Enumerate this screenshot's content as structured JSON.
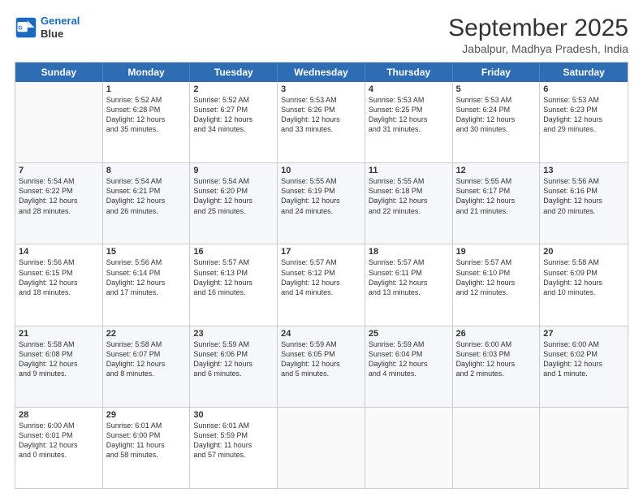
{
  "logo": {
    "line1": "General",
    "line2": "Blue"
  },
  "title": "September 2025",
  "subtitle": "Jabalpur, Madhya Pradesh, India",
  "header_days": [
    "Sunday",
    "Monday",
    "Tuesday",
    "Wednesday",
    "Thursday",
    "Friday",
    "Saturday"
  ],
  "rows": [
    [
      {
        "day": "",
        "info": ""
      },
      {
        "day": "1",
        "info": "Sunrise: 5:52 AM\nSunset: 6:28 PM\nDaylight: 12 hours\nand 35 minutes."
      },
      {
        "day": "2",
        "info": "Sunrise: 5:52 AM\nSunset: 6:27 PM\nDaylight: 12 hours\nand 34 minutes."
      },
      {
        "day": "3",
        "info": "Sunrise: 5:53 AM\nSunset: 6:26 PM\nDaylight: 12 hours\nand 33 minutes."
      },
      {
        "day": "4",
        "info": "Sunrise: 5:53 AM\nSunset: 6:25 PM\nDaylight: 12 hours\nand 31 minutes."
      },
      {
        "day": "5",
        "info": "Sunrise: 5:53 AM\nSunset: 6:24 PM\nDaylight: 12 hours\nand 30 minutes."
      },
      {
        "day": "6",
        "info": "Sunrise: 5:53 AM\nSunset: 6:23 PM\nDaylight: 12 hours\nand 29 minutes."
      }
    ],
    [
      {
        "day": "7",
        "info": "Sunrise: 5:54 AM\nSunset: 6:22 PM\nDaylight: 12 hours\nand 28 minutes."
      },
      {
        "day": "8",
        "info": "Sunrise: 5:54 AM\nSunset: 6:21 PM\nDaylight: 12 hours\nand 26 minutes."
      },
      {
        "day": "9",
        "info": "Sunrise: 5:54 AM\nSunset: 6:20 PM\nDaylight: 12 hours\nand 25 minutes."
      },
      {
        "day": "10",
        "info": "Sunrise: 5:55 AM\nSunset: 6:19 PM\nDaylight: 12 hours\nand 24 minutes."
      },
      {
        "day": "11",
        "info": "Sunrise: 5:55 AM\nSunset: 6:18 PM\nDaylight: 12 hours\nand 22 minutes."
      },
      {
        "day": "12",
        "info": "Sunrise: 5:55 AM\nSunset: 6:17 PM\nDaylight: 12 hours\nand 21 minutes."
      },
      {
        "day": "13",
        "info": "Sunrise: 5:56 AM\nSunset: 6:16 PM\nDaylight: 12 hours\nand 20 minutes."
      }
    ],
    [
      {
        "day": "14",
        "info": "Sunrise: 5:56 AM\nSunset: 6:15 PM\nDaylight: 12 hours\nand 18 minutes."
      },
      {
        "day": "15",
        "info": "Sunrise: 5:56 AM\nSunset: 6:14 PM\nDaylight: 12 hours\nand 17 minutes."
      },
      {
        "day": "16",
        "info": "Sunrise: 5:57 AM\nSunset: 6:13 PM\nDaylight: 12 hours\nand 16 minutes."
      },
      {
        "day": "17",
        "info": "Sunrise: 5:57 AM\nSunset: 6:12 PM\nDaylight: 12 hours\nand 14 minutes."
      },
      {
        "day": "18",
        "info": "Sunrise: 5:57 AM\nSunset: 6:11 PM\nDaylight: 12 hours\nand 13 minutes."
      },
      {
        "day": "19",
        "info": "Sunrise: 5:57 AM\nSunset: 6:10 PM\nDaylight: 12 hours\nand 12 minutes."
      },
      {
        "day": "20",
        "info": "Sunrise: 5:58 AM\nSunset: 6:09 PM\nDaylight: 12 hours\nand 10 minutes."
      }
    ],
    [
      {
        "day": "21",
        "info": "Sunrise: 5:58 AM\nSunset: 6:08 PM\nDaylight: 12 hours\nand 9 minutes."
      },
      {
        "day": "22",
        "info": "Sunrise: 5:58 AM\nSunset: 6:07 PM\nDaylight: 12 hours\nand 8 minutes."
      },
      {
        "day": "23",
        "info": "Sunrise: 5:59 AM\nSunset: 6:06 PM\nDaylight: 12 hours\nand 6 minutes."
      },
      {
        "day": "24",
        "info": "Sunrise: 5:59 AM\nSunset: 6:05 PM\nDaylight: 12 hours\nand 5 minutes."
      },
      {
        "day": "25",
        "info": "Sunrise: 5:59 AM\nSunset: 6:04 PM\nDaylight: 12 hours\nand 4 minutes."
      },
      {
        "day": "26",
        "info": "Sunrise: 6:00 AM\nSunset: 6:03 PM\nDaylight: 12 hours\nand 2 minutes."
      },
      {
        "day": "27",
        "info": "Sunrise: 6:00 AM\nSunset: 6:02 PM\nDaylight: 12 hours\nand 1 minute."
      }
    ],
    [
      {
        "day": "28",
        "info": "Sunrise: 6:00 AM\nSunset: 6:01 PM\nDaylight: 12 hours\nand 0 minutes."
      },
      {
        "day": "29",
        "info": "Sunrise: 6:01 AM\nSunset: 6:00 PM\nDaylight: 11 hours\nand 58 minutes."
      },
      {
        "day": "30",
        "info": "Sunrise: 6:01 AM\nSunset: 5:59 PM\nDaylight: 11 hours\nand 57 minutes."
      },
      {
        "day": "",
        "info": ""
      },
      {
        "day": "",
        "info": ""
      },
      {
        "day": "",
        "info": ""
      },
      {
        "day": "",
        "info": ""
      }
    ]
  ]
}
